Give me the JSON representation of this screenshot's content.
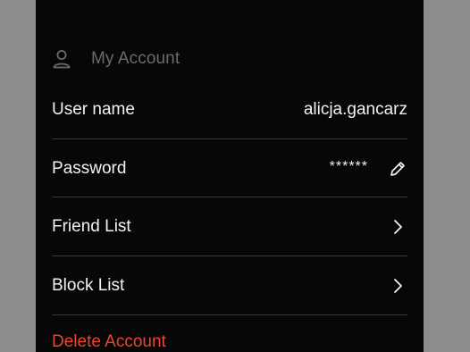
{
  "colors": {
    "backdrop": "#8d8d8d",
    "panel": "#070707",
    "text": "#f2f2f2",
    "muted": "#6b6b6b",
    "divider": "#3a3a3a",
    "danger": "#e9452e"
  },
  "section": {
    "icon": "user-icon",
    "title": "My Account"
  },
  "rows": [
    {
      "label": "User name",
      "value": "alicja.gancarz"
    },
    {
      "label": "Password",
      "value": "******",
      "icon": "pencil-icon"
    },
    {
      "label": "Friend List",
      "icon": "chevron-right-icon"
    },
    {
      "label": "Block List",
      "icon": "chevron-right-icon"
    }
  ],
  "danger_action": {
    "label": "Delete Account"
  }
}
